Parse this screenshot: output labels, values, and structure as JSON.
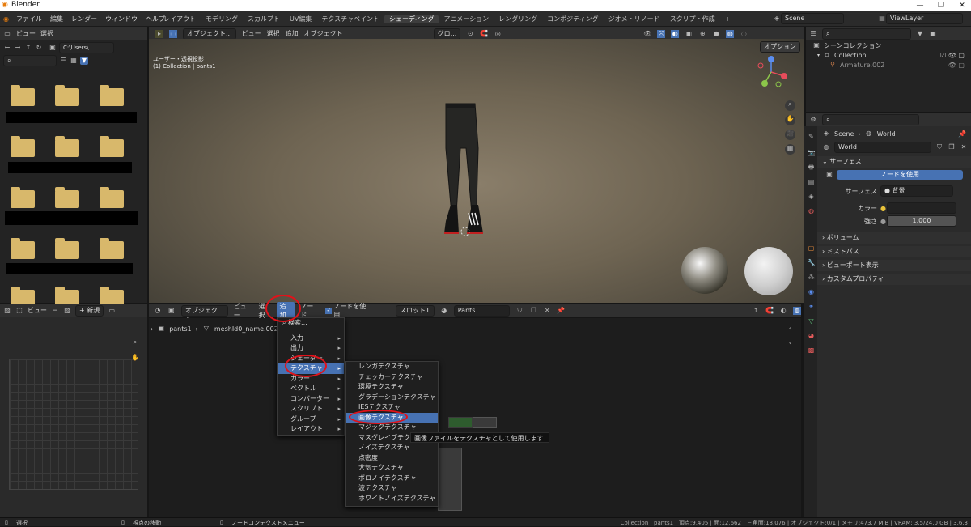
{
  "window": {
    "title": "Blender"
  },
  "menu": [
    "ファイル",
    "編集",
    "レンダー",
    "ウィンドウ",
    "ヘルプ"
  ],
  "workspaces": [
    "レイアウト",
    "モデリング",
    "スカルプト",
    "UV編集",
    "テクスチャペイント",
    "シェーディング",
    "アニメーション",
    "レンダリング",
    "コンポジティング",
    "ジオメトリノード",
    "スクリプト作成"
  ],
  "active_workspace": "シェーディング",
  "scene": {
    "name": "Scene",
    "view_layer": "ViewLayer"
  },
  "file_browser": {
    "menu_view": "ビュー",
    "menu_select": "選択",
    "path": "C:\\Users\\"
  },
  "viewport": {
    "mode": "オブジェクト...",
    "menus": [
      "ビュー",
      "選択",
      "追加",
      "オブジェクト"
    ],
    "transform": "グロ...",
    "options": "オプション",
    "info_line1": "ユーザー・透視投影",
    "info_line2": "(1) Collection | pants1"
  },
  "node_header": {
    "mode": "オブジェクト",
    "menus": [
      "ビュー",
      "選択",
      "追加",
      "ノード"
    ],
    "use_nodes_label": "ノードを使用",
    "slot": "スロット1",
    "material": "Pants",
    "breadcrumb": [
      "pants1",
      "meshId0_name.002"
    ]
  },
  "image_editor": {
    "view": "ビュー",
    "new": "新規"
  },
  "add_menu": {
    "search": "検索...",
    "items": [
      "入力",
      "出力",
      "シェーダー",
      "テクスチャ",
      "カラー",
      "ベクトル",
      "コンバーター",
      "スクリプト",
      "グループ",
      "レイアウト"
    ],
    "active": "テクスチャ"
  },
  "texture_menu": {
    "items": [
      "レンガテクスチャ",
      "チェッカーテクスチャ",
      "環境テクスチャ",
      "グラデーションテクスチャ",
      "IESテクスチャ",
      "画像テクスチャ",
      "マジックテクスチャ",
      "マスグレイブテクスチャ",
      "ノイズテクスチャ",
      "点密度",
      "大気テクスチャ",
      "ボロノイテクスチャ",
      "波テクスチャ",
      "ホワイトノイズテクスチャ"
    ],
    "active": "画像テクスチャ",
    "tooltip": "画像ファイルをテクスチャとして使用します."
  },
  "outliner": {
    "root": "シーンコレクション",
    "collection": "Collection",
    "object": "Armature.002"
  },
  "properties": {
    "breadcrumb_scene": "Scene",
    "breadcrumb_world": "World",
    "world_name": "World",
    "surface_section": "サーフェス",
    "use_nodes_button": "ノードを使用",
    "surface_label": "サーフェス",
    "surface_value": "背景",
    "color_label": "カラー",
    "strength_label": "強さ",
    "strength_value": "1.000",
    "collapsed_sections": [
      "ボリューム",
      "ミストパス",
      "ビューポート表示",
      "カスタムプロパティ"
    ]
  },
  "status": {
    "select": "選択",
    "move_view": "視点の移動",
    "context": "ノードコンテクストメニュー",
    "stats": "Collection | pants1 | 頂点:9,405 | 面:12,662 | 三角面:18,076 | オブジェクト:0/1 | メモリ:473.7 MiB | VRAM: 3.5/24.0 GB | 3.6.3"
  },
  "colors": {
    "accent": "#4772b3",
    "highlight_circle": "#e0121a",
    "folder": "#d8b86b"
  }
}
